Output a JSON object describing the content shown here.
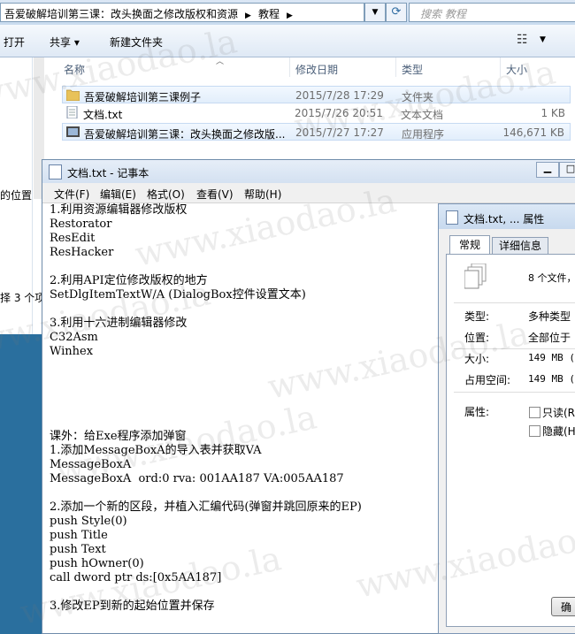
{
  "explorer": {
    "breadcrumb": [
      "吾爱破解培训第三课：改头换面之修改版权和资源",
      "教程"
    ],
    "search_placeholder": "搜索 教程",
    "toolbar": {
      "open": "打开",
      "share": "共享 ▾",
      "new_folder": "新建文件夹"
    },
    "columns": {
      "name": "名称",
      "date": "修改日期",
      "type": "类型",
      "size": "大小"
    },
    "files": [
      {
        "name": "吾爱破解培训第三课例子",
        "date": "2015/7/28 17:29",
        "type": "文件夹",
        "size": "",
        "icon": "folder-icon"
      },
      {
        "name": "文档.txt",
        "date": "2015/7/26 20:51",
        "type": "文本文档",
        "size": "1 KB",
        "icon": "text-file-icon"
      },
      {
        "name": "吾爱破解培训第三课：改头换面之修改版...",
        "date": "2015/7/27 17:27",
        "type": "应用程序",
        "size": "146,671 KB",
        "icon": "app-icon"
      }
    ],
    "nav_fragment": "的位置",
    "status_fragment": "择 3 个项"
  },
  "notepad": {
    "title": "文档.txt - 记事本",
    "menu": [
      "文件(F)",
      "编辑(E)",
      "格式(O)",
      "查看(V)",
      "帮助(H)"
    ],
    "lines": [
      "1.利用资源编辑器修改版权",
      "Restorator",
      "ResEdit",
      "ResHacker",
      "",
      "2.利用API定位修改版权的地方",
      "SetDlgItemTextW/A (DialogBox控件设置文本)",
      "",
      "3.利用十六进制编辑器修改",
      "C32Asm",
      "Winhex",
      "",
      "",
      "",
      "",
      "",
      "课外：给Exe程序添加弹窗",
      "1.添加MessageBoxA的导入表并获取VA",
      "MessageBoxA",
      "MessageBoxA  ord:0 rva: 001AA187 VA:005AA187",
      "",
      "2.添加一个新的区段，并植入汇编代码(弹窗并跳回原来的EP)",
      "push Style(0)",
      "push Title",
      "push Text",
      "push hOwner(0)",
      "call dword ptr ds:[0x5AA187]",
      "",
      "3.修改EP到新的起始位置并保存"
    ]
  },
  "properties": {
    "title": "文档.txt, ... 属性",
    "tabs": [
      "常规",
      "详细信息"
    ],
    "summary": "8 个文件，",
    "rows": [
      {
        "label": "类型:",
        "value": "多种类型"
      },
      {
        "label": "位置:",
        "value": "全部位于"
      },
      {
        "label": "大小:",
        "value": "149 MB (1"
      },
      {
        "label": "占用空间:",
        "value": "149 MB (1"
      }
    ],
    "attr_label": "属性:",
    "attrs": [
      "只读(R",
      "隐藏(H"
    ],
    "button": "确"
  },
  "watermark": "www.xiaodao.la"
}
